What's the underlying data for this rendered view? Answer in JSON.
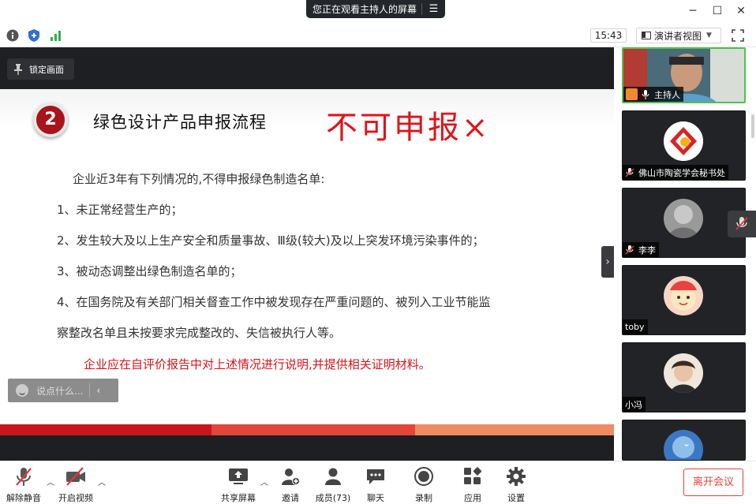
{
  "window": {
    "share_banner": "您正在观看主持人的屏幕",
    "clock": "15:43",
    "view_mode": "演讲者视图"
  },
  "content": {
    "lock_button": "锁定画面",
    "comment_placeholder": "说点什么..."
  },
  "slide": {
    "number": "2",
    "title": "绿色设计产品申报流程",
    "stamp": "不可申报×",
    "intro": "企业近3年有下列情况的,不得申报绿色制造名单:",
    "items": [
      "1、未正常经营生产的；",
      "2、发生较大及以上生产安全和质量事故、Ⅲ级(较大)及以上突发环境污染事件的；",
      "3、被动态调整出绿色制造名单的；",
      "4、在国务院及有关部门相关督查工作中被发现存在严重问题的、被列入工业节能监",
      "察整改名单且未按要求完成整改的、失信被执行人等。"
    ],
    "note": "企业应在自评价报告中对上述情况进行说明,并提供相关证明材料。",
    "colors": {
      "bar1": "#c8161d",
      "bar2": "#e2453a",
      "bar3": "#ef8a62"
    }
  },
  "gallery": {
    "participants": [
      {
        "name": "主持人",
        "role": "host"
      },
      {
        "name": "佛山市陶瓷学会秘书处",
        "muted": true
      },
      {
        "name": "李李",
        "muted": true
      },
      {
        "name": "toby"
      },
      {
        "name": "小冯"
      }
    ]
  },
  "toolbar": {
    "unmute": "解除静音",
    "start_video": "开启视频",
    "share_screen": "共享屏幕",
    "invite": "邀请",
    "members": "成员(73)",
    "chat": "聊天",
    "record": "录制",
    "apps": "应用",
    "settings": "设置",
    "leave": "离开会议"
  }
}
